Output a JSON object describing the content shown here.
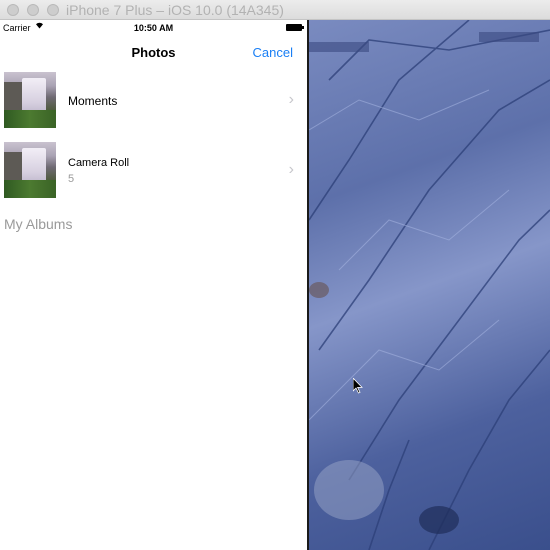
{
  "simulator": {
    "title": "iPhone 7 Plus – iOS 10.0 (14A345)"
  },
  "status_bar": {
    "carrier": "Carrier",
    "time": "10:50 AM"
  },
  "navigation": {
    "title": "Photos",
    "cancel_label": "Cancel"
  },
  "albums": [
    {
      "name": "Moments",
      "count": ""
    },
    {
      "name": "Camera Roll",
      "count": "5"
    }
  ],
  "section": {
    "title": "My Albums"
  },
  "colors": {
    "accent": "#1a7ff5",
    "secondary_text": "#9a9a9a",
    "chevron": "#c7c7cc"
  },
  "icons": {
    "wifi": "wifi-icon",
    "battery": "battery-icon",
    "chevron": "chevron-right-icon",
    "cursor": "mouse-cursor-icon"
  }
}
